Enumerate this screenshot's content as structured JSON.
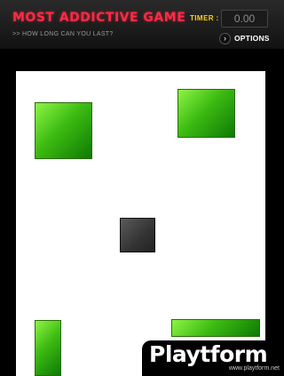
{
  "header": {
    "title": "MOST ADDICTIVE GAME",
    "subtitle": ">> HOW LONG CAN YOU LAST?",
    "timer_label": "TIMER :",
    "timer_value": "0.00",
    "options_label": "OPTIONS",
    "options_icon": "chevron-right-icon"
  },
  "game": {
    "arena_color": "#ffffff",
    "enemy_color": "#3dbb12",
    "player_color": "#333333"
  },
  "watermark": {
    "name": "Playtform",
    "url": "www.playtform.net"
  }
}
